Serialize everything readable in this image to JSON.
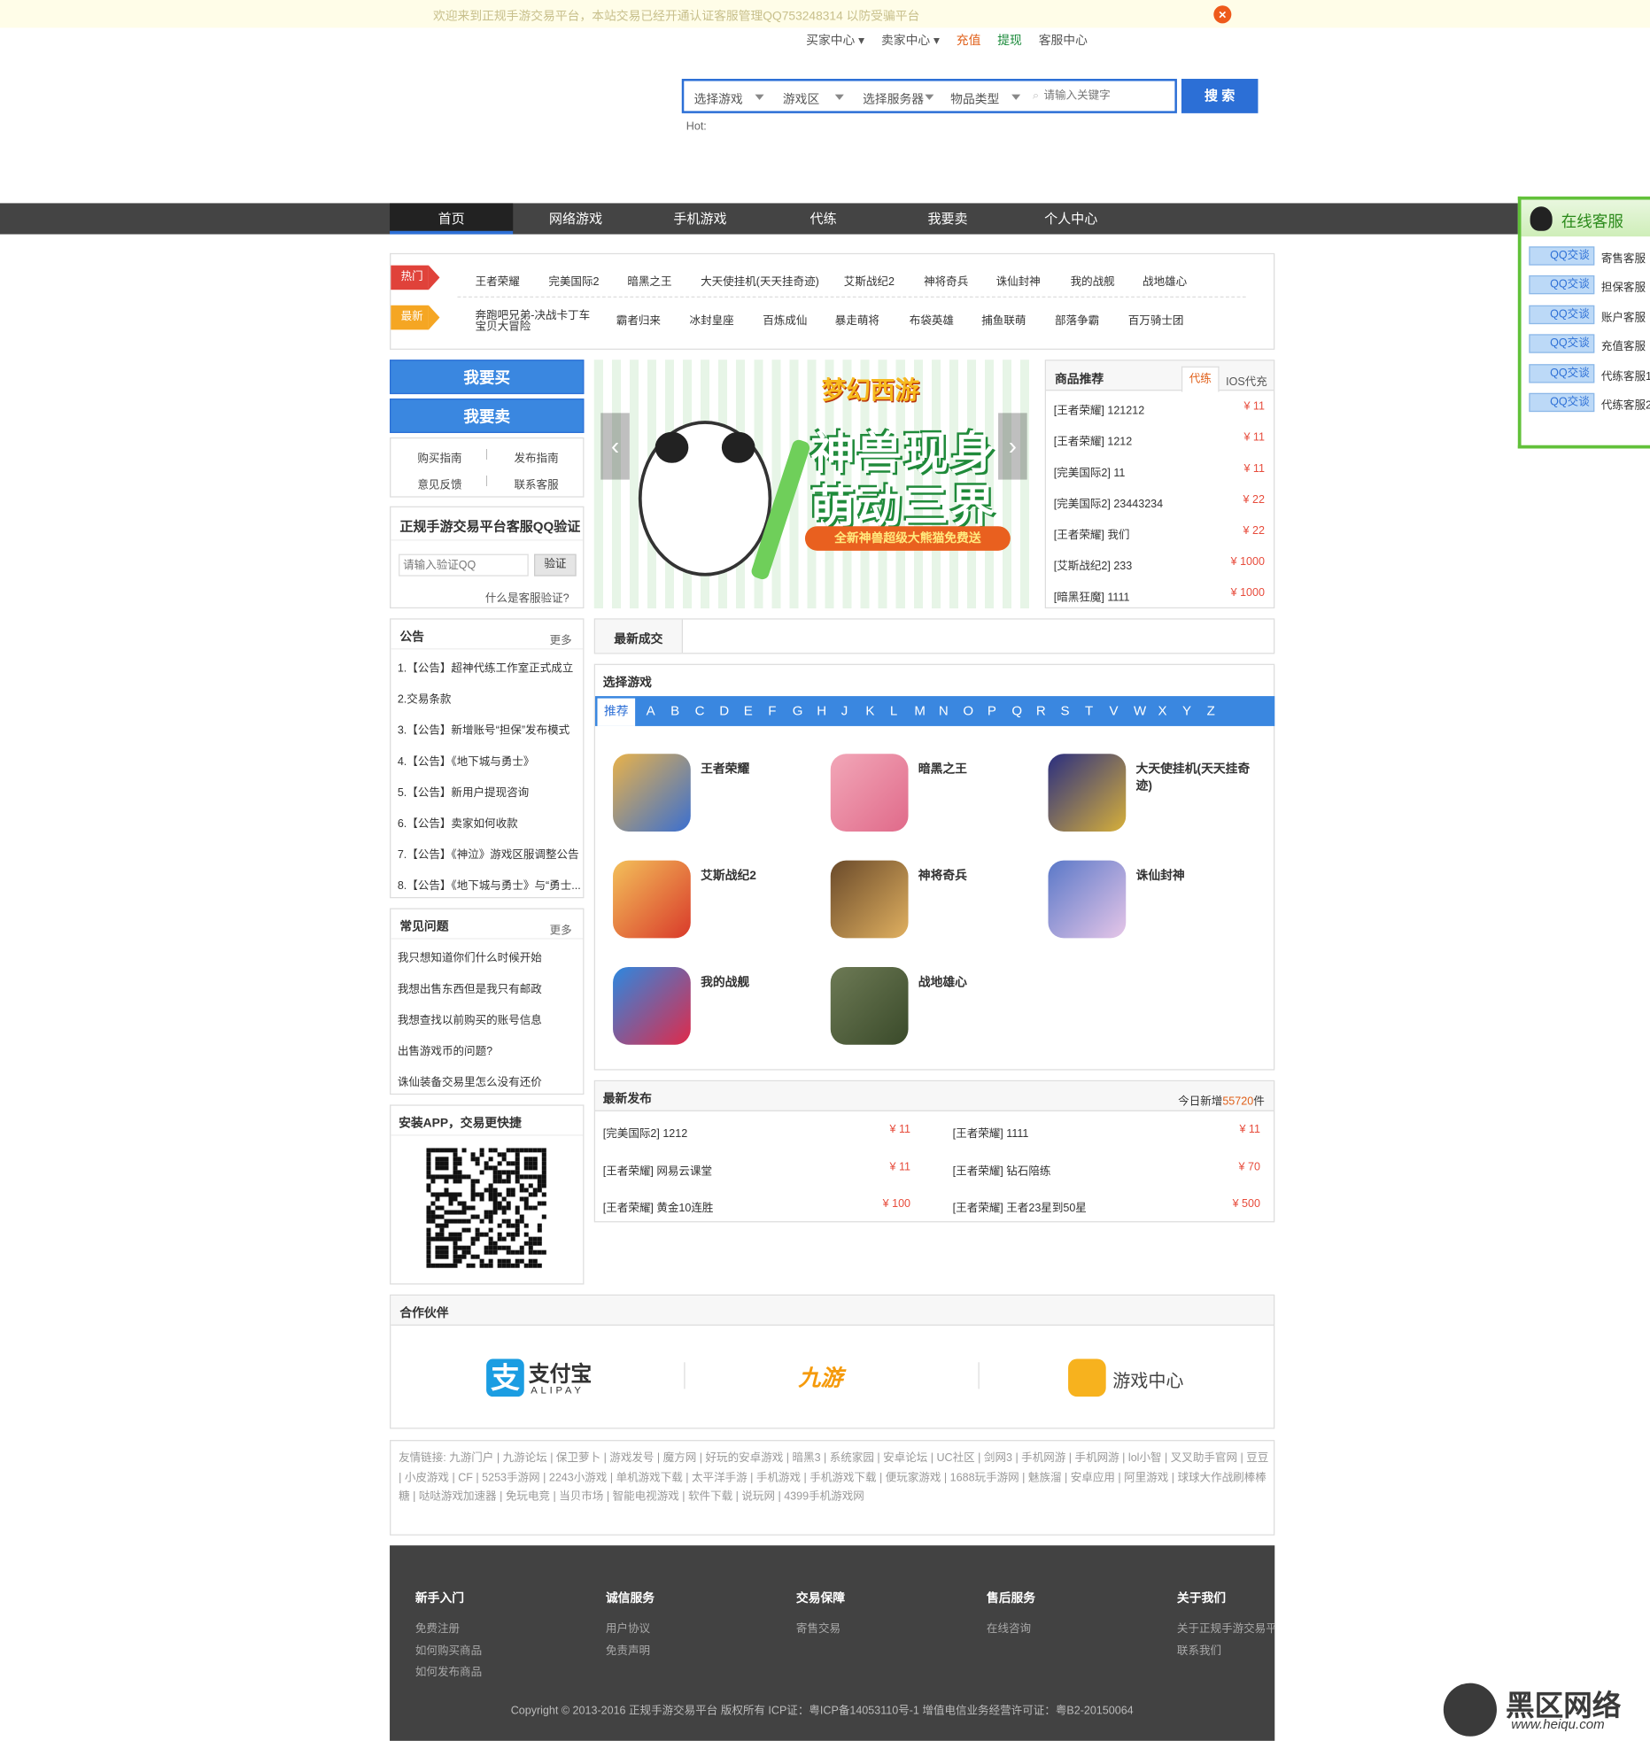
{
  "notice": {
    "text": "欢迎来到正规手游交易平台，本站交易已经开通认证客服管理QQ753248314 以防受骗平台",
    "close": "×"
  },
  "toplinks": [
    "买家中心 ▾",
    "卖家中心 ▾",
    "充值",
    "提现",
    "客服中心"
  ],
  "search": {
    "game": "选择游戏",
    "area": "游戏区",
    "server": "选择服务器",
    "type": "物品类型",
    "placeholder": "请输入关键字",
    "button": "搜 索",
    "hot": "Hot:"
  },
  "nav": [
    "首页",
    "网络游戏",
    "手机游戏",
    "代练",
    "我要卖",
    "个人中心"
  ],
  "hot": {
    "tag": "热门",
    "items": [
      "王者荣耀",
      "完美国际2",
      "暗黑之王",
      "大天使挂机(天天挂奇迹)",
      "艾斯战纪2",
      "神将奇兵",
      "诛仙封神",
      "我的战舰",
      "战地雄心"
    ]
  },
  "latest": {
    "tag": "最新",
    "items": [
      "奔跑吧兄弟-决战卡丁车宝贝大冒险",
      "霸者归来",
      "冰封皇座",
      "百炼成仙",
      "暴走萌将",
      "布袋英雄",
      "捕鱼联萌",
      "部落争霸",
      "百万骑士团"
    ]
  },
  "buy_btn": "我要买",
  "sell_btn": "我要卖",
  "guides": [
    "购买指南",
    "发布指南",
    "意见反馈",
    "联系客服"
  ],
  "qqverify": {
    "title": "正规手游交易平台客服QQ验证",
    "placeholder": "请输入验证QQ",
    "button": "验证",
    "help": "什么是客服验证?"
  },
  "banner": {
    "logo": "梦幻西游",
    "title1": "神兽现身",
    "title2": "萌动三界",
    "sub": "全新神兽超级大熊猫免费送"
  },
  "recommend": {
    "title": "商品推荐",
    "tab1": "代练",
    "tab2": "IOS代充",
    "items": [
      {
        "name": "[王者荣耀] 121212",
        "price": "¥ 11"
      },
      {
        "name": "[王者荣耀] 1212",
        "price": "¥ 11"
      },
      {
        "name": "[完美国际2] 11",
        "price": "¥ 11"
      },
      {
        "name": "[完美国际2] 23443234",
        "price": "¥ 22"
      },
      {
        "name": "[王者荣耀] 我们",
        "price": "¥ 22"
      },
      {
        "name": "[艾斯战纪2] 233",
        "price": "¥ 1000"
      },
      {
        "name": "[暗黑狂魔] 1111",
        "price": "¥ 1000"
      }
    ]
  },
  "announce": {
    "title": "公告",
    "more": "更多",
    "items": [
      "1.【公告】超神代练工作室正式成立",
      "2.交易条款",
      "3.【公告】新增账号“担保”发布模式",
      "4.【公告】《地下城与勇士》",
      "5.【公告】新用户提现咨询",
      "6.【公告】卖家如何收款",
      "7.【公告】《神泣》游戏区服调整公告",
      "8.【公告】《地下城与勇士》与“勇士..."
    ]
  },
  "faq": {
    "title": "常见问题",
    "more": "更多",
    "items": [
      "我只想知道你们什么时候开始",
      "我想出售东西但是我只有邮政",
      "我想查找以前购买的账号信息",
      "出售游戏币的问题?",
      "诛仙装备交易里怎么没有还价"
    ]
  },
  "app": {
    "title": "安装APP，交易更快捷"
  },
  "deals": {
    "title": "最新成交"
  },
  "choose": {
    "title": "选择游戏",
    "tab": "推荐",
    "letters": [
      "A",
      "B",
      "C",
      "D",
      "E",
      "F",
      "G",
      "H",
      "J",
      "K",
      "L",
      "M",
      "N",
      "O",
      "P",
      "Q",
      "R",
      "S",
      "T",
      "V",
      "W",
      "X",
      "Y",
      "Z"
    ],
    "games": [
      "王者荣耀",
      "暗黑之王",
      "大天使挂机(天天挂奇迹)",
      "艾斯战纪2",
      "神将奇兵",
      "诛仙封神",
      "我的战舰",
      "战地雄心"
    ]
  },
  "publish": {
    "title": "最新发布",
    "today_label": "今日新增",
    "today_count": "55720",
    "unit": "件",
    "rows": [
      {
        "name": "[完美国际2] 1212",
        "price": "¥ 11"
      },
      {
        "name": "[王者荣耀] 1111",
        "price": "¥ 11"
      },
      {
        "name": "[王者荣耀] 网易云课堂",
        "price": "¥ 11"
      },
      {
        "name": "[王者荣耀] 钻石陪练",
        "price": "¥ 70"
      },
      {
        "name": "[王者荣耀] 黄金10连胜",
        "price": "¥ 100"
      },
      {
        "name": "[王者荣耀] 王者23星到50星",
        "price": "¥ 500"
      }
    ]
  },
  "partners": {
    "title": "合作伙伴",
    "alipay": "支付宝",
    "alipay_en": "ALIPAY",
    "jiuyou": "九游",
    "gamecenter": "游戏中心"
  },
  "friendlinks": "友情链接: 九游门户 | 九游论坛 | 保卫萝卜 | 游戏发号 | 魔方网 | 好玩的安卓游戏 | 暗黑3 | 系统家园 | 安卓论坛 | UC社区 | 剑网3 | 手机网游 | 手机网游 | lol小智 | 叉叉助手官网 | 豆豆 | 小皮游戏 | CF | 5253手游网 | 2243小游戏 | 单机游戏下载 | 太平洋手游 | 手机游戏 | 手机游戏下载 | 便玩家游戏 | 1688玩手游网 | 魅族溜 | 安卓应用 | 阿里游戏 | 球球大作战刷棒棒糖 | 哒哒游戏加速器 | 免玩电竞 | 当贝市场 | 智能电视游戏 | 软件下载 | 说玩网 | 4399手机游戏网",
  "footer": {
    "cols": [
      {
        "title": "新手入门",
        "links": [
          "免费注册",
          "如何购买商品",
          "如何发布商品"
        ]
      },
      {
        "title": "诚信服务",
        "links": [
          "用户协议",
          "免责声明"
        ]
      },
      {
        "title": "交易保障",
        "links": [
          "寄售交易"
        ]
      },
      {
        "title": "售后服务",
        "links": [
          "在线咨询"
        ]
      },
      {
        "title": "关于我们",
        "links": [
          "关于正规手游交易平台",
          "联系我们"
        ]
      }
    ],
    "copyright": "Copyright © 2013-2016 正规手游交易平台   版权所有   ICP证：粤ICP备14053110号-1   增值电信业务经营许可证：粤B2-20150064"
  },
  "service": {
    "title": "在线客服",
    "btn": "QQ交谈",
    "items": [
      "寄售客服",
      "担保客服",
      "账户客服",
      "充值客服",
      "代练客服1",
      "代练客服2"
    ]
  },
  "watermark": {
    "cn": "黑区网络",
    "url": "www.heiqu.com"
  }
}
